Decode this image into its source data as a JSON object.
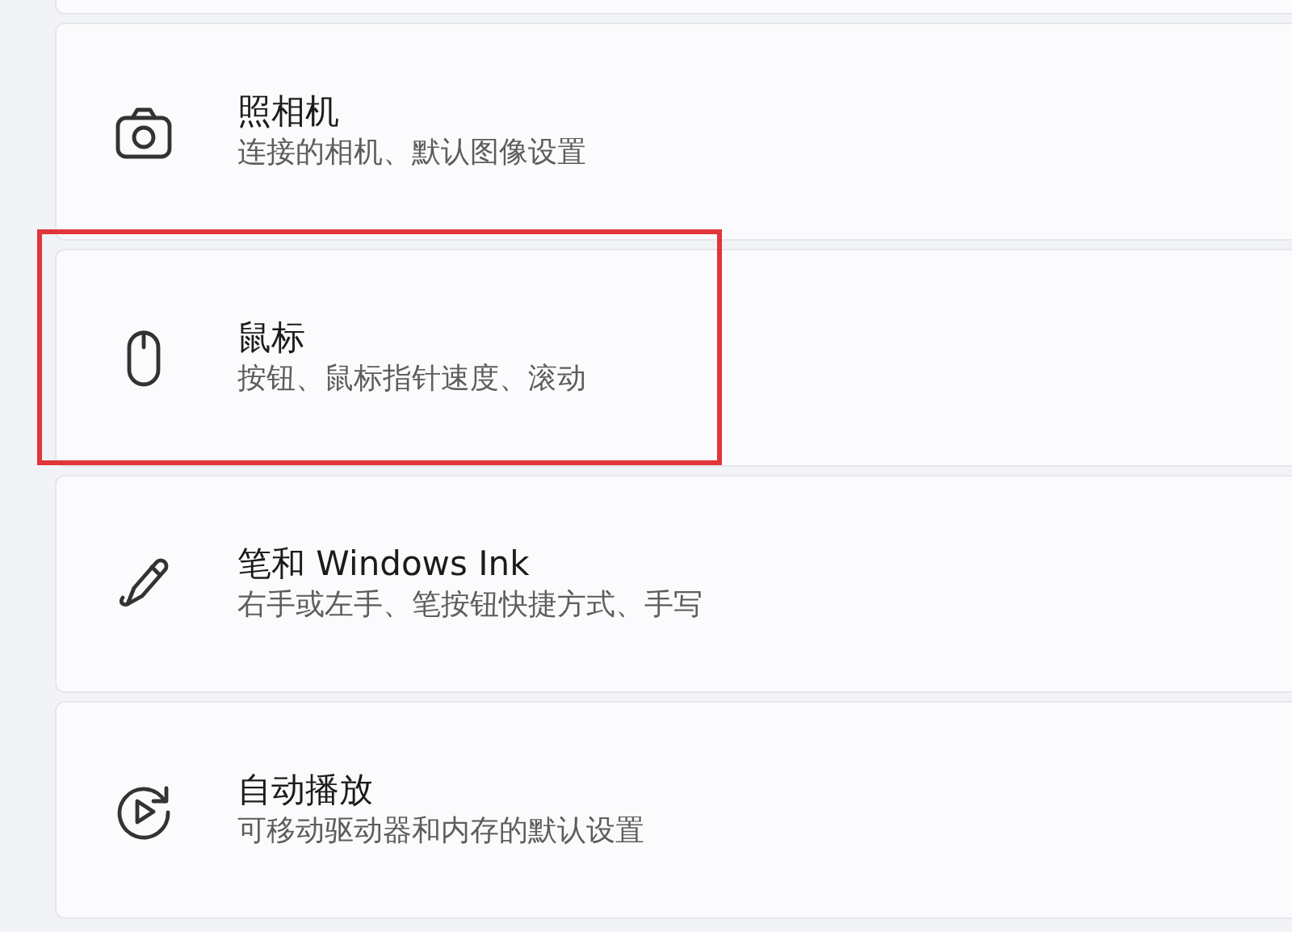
{
  "items": [
    {
      "title": "照相机",
      "subtitle": "连接的相机、默认图像设置",
      "highlighted": false
    },
    {
      "title": "鼠标",
      "subtitle": "按钮、鼠标指针速度、滚动",
      "highlighted": true
    },
    {
      "title": "笔和 Windows Ink",
      "subtitle": "右手或左手、笔按钮快捷方式、手写",
      "highlighted": false
    },
    {
      "title": "自动播放",
      "subtitle": "可移动驱动器和内存的默认设置",
      "highlighted": false
    }
  ]
}
